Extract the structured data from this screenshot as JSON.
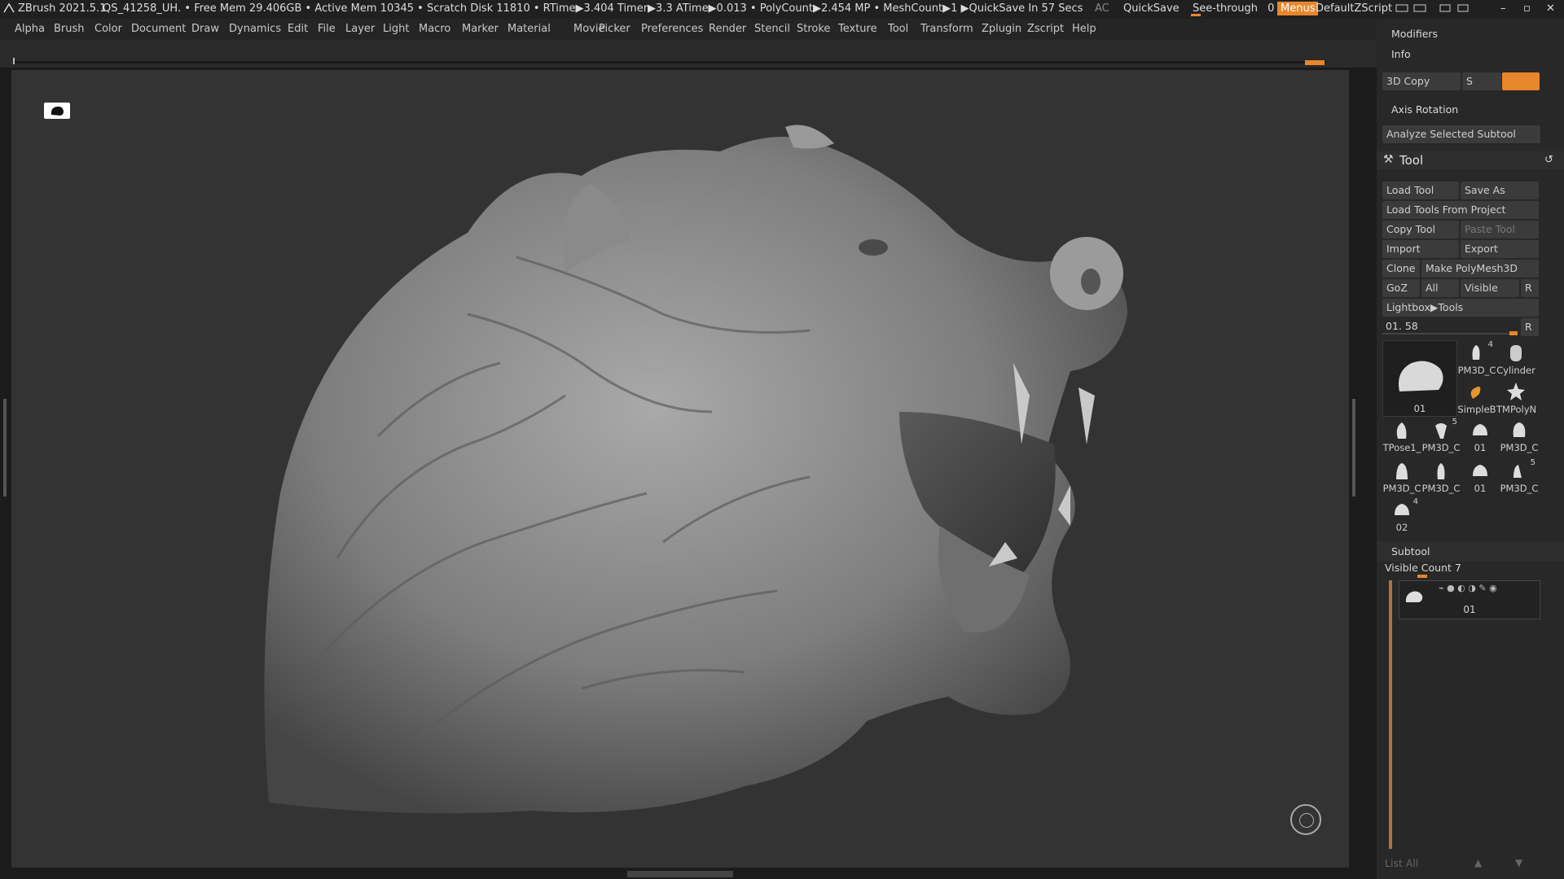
{
  "titlebar": {
    "app": "ZBrush 2021.5.1",
    "document": "QS_41258_UH",
    "stats": ".. • Free Mem 29.406GB • Active Mem 10345 • Scratch Disk 11810 • RTime▶3.404 Timer▶3.3 ATime▶0.013 • PolyCount▶2.454 MP • MeshCount▶1 ▶QuickSave In 57 Secs",
    "ac": "AC",
    "quicksave": "QuickSave",
    "see_through": "See-through",
    "see_through_value": "0",
    "menus": "Menus",
    "script": "DefaultZScript"
  },
  "menu": [
    "Alpha",
    "Brush",
    "Color",
    "Document",
    "Draw",
    "Dynamics",
    "Edit",
    "File",
    "Layer",
    "Light",
    "Macro",
    "Marker",
    "Material",
    "Movie",
    "Picker",
    "Preferences",
    "Render",
    "Stencil",
    "Stroke",
    "Texture",
    "Tool",
    "Transform",
    "Zplugin",
    "Zscript",
    "Help"
  ],
  "panel": {
    "modifiers": "Modifiers",
    "info": "Info",
    "copy3d": "3D Copy",
    "s_label": "S",
    "axis_rotation": "Axis Rotation",
    "analyze": "Analyze Selected Subtool",
    "tool_title": "Tool",
    "load_tool": "Load Tool",
    "save_as": "Save As",
    "load_from_project": "Load Tools From Project",
    "copy_tool": "Copy Tool",
    "paste_tool": "Paste Tool",
    "import": "Import",
    "export": "Export",
    "clone": "Clone",
    "make_polymesh": "Make PolyMesh3D",
    "goz": "GoZ",
    "all": "All",
    "visible": "Visible",
    "r": "R",
    "lightbox_tools": "Lightbox▶Tools",
    "slider_label": "01. 58",
    "main_thumb_label": "01",
    "thumbs": [
      {
        "label": "PM3D_C",
        "badge": "4"
      },
      {
        "label": "Cylinder",
        "badge": ""
      },
      {
        "label": "SimpleB",
        "badge": ""
      },
      {
        "label": "TMPolyN",
        "badge": ""
      },
      {
        "label": "TPose1_",
        "badge": ""
      },
      {
        "label": "PM3D_C",
        "badge": "5"
      },
      {
        "label": "01",
        "badge": ""
      },
      {
        "label": "PM3D_C",
        "badge": ""
      },
      {
        "label": "PM3D_C",
        "badge": ""
      },
      {
        "label": "PM3D_C",
        "badge": ""
      },
      {
        "label": "01",
        "badge": ""
      },
      {
        "label": "PM3D_C",
        "badge": "5"
      },
      {
        "label": "02",
        "badge": "4"
      }
    ],
    "subtool": "Subtool",
    "visible_count": "Visible Count 7",
    "subtool_item": "01",
    "list_all": "List All"
  }
}
